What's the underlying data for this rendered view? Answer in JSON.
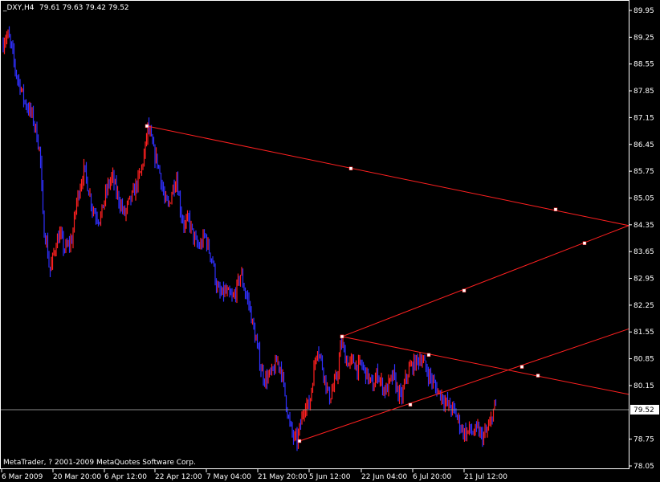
{
  "header": {
    "symbol_tf": "_DXY,H4",
    "ohlc": "79.61 79.63 79.42 79.52"
  },
  "copyright": "MetaTrader, ? 2001-2009 MetaQuotes Software Corp.",
  "colors": {
    "background": "#000000",
    "bull": "#ff2020",
    "bear": "#3030ff",
    "trendline": "#ff2020",
    "price_line": "#8c8c8c",
    "text": "#ffffff"
  },
  "chart_data": {
    "type": "candlestick",
    "ylim": [
      78.05,
      89.95
    ],
    "y_ticks": [
      "89.95",
      "89.25",
      "88.55",
      "87.85",
      "87.15",
      "86.45",
      "85.75",
      "85.05",
      "84.35",
      "83.65",
      "82.95",
      "82.25",
      "81.55",
      "80.85",
      "80.15",
      "78.75",
      "78.05"
    ],
    "x_ticks": [
      "6 Mar 2009",
      "20 Mar 20:00",
      "6 Apr 12:00",
      "22 Apr 12:00",
      "7 May 04:00",
      "21 May 20:00",
      "5 Jun 12:00",
      "22 Jun 04:00",
      "6 Jul 20:00",
      "21 Jul 12:00"
    ],
    "current_price": {
      "label": "79.52",
      "value": 79.52
    },
    "price_path": [
      [
        0,
        88.6
      ],
      [
        5,
        89.2
      ],
      [
        10,
        89.3
      ],
      [
        15,
        88.9
      ],
      [
        20,
        88.3
      ],
      [
        25,
        88.0
      ],
      [
        30,
        87.6
      ],
      [
        35,
        87.4
      ],
      [
        40,
        87.2
      ],
      [
        45,
        86.8
      ],
      [
        50,
        86.2
      ],
      [
        54,
        84.3
      ],
      [
        58,
        83.9
      ],
      [
        62,
        83.1
      ],
      [
        65,
        83.4
      ],
      [
        70,
        83.9
      ],
      [
        75,
        84.1
      ],
      [
        80,
        83.7
      ],
      [
        85,
        83.8
      ],
      [
        90,
        84.0
      ],
      [
        95,
        84.9
      ],
      [
        100,
        85.4
      ],
      [
        105,
        85.8
      ],
      [
        110,
        85.3
      ],
      [
        115,
        84.8
      ],
      [
        120,
        84.6
      ],
      [
        125,
        84.5
      ],
      [
        130,
        85.0
      ],
      [
        135,
        85.4
      ],
      [
        140,
        85.6
      ],
      [
        145,
        85.2
      ],
      [
        150,
        84.9
      ],
      [
        155,
        84.6
      ],
      [
        160,
        84.9
      ],
      [
        165,
        85.1
      ],
      [
        170,
        85.4
      ],
      [
        175,
        85.7
      ],
      [
        180,
        86.2
      ],
      [
        184,
        86.9
      ],
      [
        188,
        86.6
      ],
      [
        192,
        86.2
      ],
      [
        196,
        86.0
      ],
      [
        200,
        85.6
      ],
      [
        205,
        85.0
      ],
      [
        210,
        84.8
      ],
      [
        215,
        85.3
      ],
      [
        220,
        85.6
      ],
      [
        225,
        84.7
      ],
      [
        230,
        84.3
      ],
      [
        235,
        84.5
      ],
      [
        240,
        84.1
      ],
      [
        245,
        83.8
      ],
      [
        250,
        83.8
      ],
      [
        255,
        84.1
      ],
      [
        260,
        83.7
      ],
      [
        265,
        83.4
      ],
      [
        270,
        82.7
      ],
      [
        275,
        82.5
      ],
      [
        280,
        82.6
      ],
      [
        285,
        82.5
      ],
      [
        290,
        82.4
      ],
      [
        295,
        82.7
      ],
      [
        300,
        83.1
      ],
      [
        305,
        82.6
      ],
      [
        310,
        82.3
      ],
      [
        315,
        81.7
      ],
      [
        320,
        81.2
      ],
      [
        325,
        80.6
      ],
      [
        330,
        80.3
      ],
      [
        335,
        80.4
      ],
      [
        340,
        80.5
      ],
      [
        345,
        80.8
      ],
      [
        350,
        80.6
      ],
      [
        355,
        79.9
      ],
      [
        360,
        79.2
      ],
      [
        365,
        78.8
      ],
      [
        370,
        78.7
      ],
      [
        375,
        79.2
      ],
      [
        380,
        79.7
      ],
      [
        385,
        79.6
      ],
      [
        390,
        80.4
      ],
      [
        395,
        81.2
      ],
      [
        400,
        80.8
      ],
      [
        405,
        80.3
      ],
      [
        410,
        79.8
      ],
      [
        415,
        80.1
      ],
      [
        420,
        80.4
      ],
      [
        425,
        81.3
      ],
      [
        430,
        80.9
      ],
      [
        435,
        80.7
      ],
      [
        440,
        80.8
      ],
      [
        445,
        80.6
      ],
      [
        450,
        80.7
      ],
      [
        455,
        80.5
      ],
      [
        460,
        80.3
      ],
      [
        465,
        80.1
      ],
      [
        470,
        80.5
      ],
      [
        475,
        80.2
      ],
      [
        480,
        80.0
      ],
      [
        485,
        80.2
      ],
      [
        490,
        80.4
      ],
      [
        495,
        80.0
      ],
      [
        500,
        79.8
      ],
      [
        505,
        80.3
      ],
      [
        510,
        80.6
      ],
      [
        515,
        80.7
      ],
      [
        520,
        80.8
      ],
      [
        525,
        80.9
      ],
      [
        530,
        80.6
      ],
      [
        535,
        80.4
      ],
      [
        540,
        80.2
      ],
      [
        545,
        80.0
      ],
      [
        550,
        79.9
      ],
      [
        555,
        79.7
      ],
      [
        560,
        79.6
      ],
      [
        565,
        79.5
      ],
      [
        570,
        79.3
      ],
      [
        575,
        79.0
      ],
      [
        580,
        78.9
      ],
      [
        585,
        79.0
      ],
      [
        590,
        78.9
      ],
      [
        595,
        79.0
      ],
      [
        600,
        78.8
      ],
      [
        605,
        78.9
      ],
      [
        610,
        79.1
      ],
      [
        614,
        79.5
      ],
      [
        618,
        79.6
      ]
    ],
    "trendlines": [
      {
        "points": [
          [
            183,
            86.93
          ],
          [
            783,
            84.33
          ]
        ],
        "markers": [
          [
            183,
            86.93
          ],
          [
            437,
            85.82
          ],
          [
            692,
            84.75
          ]
        ]
      },
      {
        "points": [
          [
            426,
            81.43
          ],
          [
            783,
            84.33
          ]
        ],
        "markers": [
          [
            426,
            81.43
          ],
          [
            578,
            82.63
          ],
          [
            728,
            83.87
          ]
        ]
      },
      {
        "points": [
          [
            426,
            81.43
          ],
          [
            783,
            79.92
          ]
        ],
        "markers": [
          [
            426,
            81.43
          ],
          [
            534,
            80.95
          ],
          [
            670,
            80.41
          ]
        ]
      },
      {
        "points": [
          [
            373,
            78.7
          ],
          [
            783,
            81.63
          ]
        ],
        "markers": [
          [
            373,
            78.7
          ],
          [
            511,
            79.65
          ],
          [
            650,
            80.64
          ]
        ]
      }
    ]
  }
}
